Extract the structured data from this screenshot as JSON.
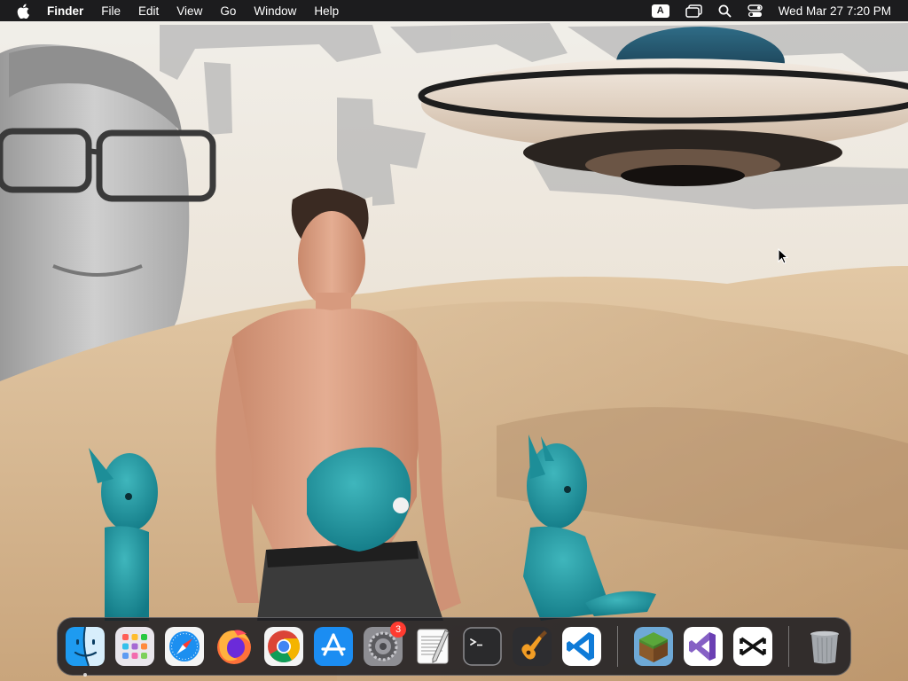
{
  "menubar": {
    "app_name": "Finder",
    "menus": [
      "File",
      "Edit",
      "View",
      "Go",
      "Window",
      "Help"
    ],
    "input_source": "A",
    "clock": "Wed Mar 27  7:20 PM",
    "status_icons": [
      "input-source-icon",
      "screen-mirroring-icon",
      "spotlight-search-icon",
      "control-center-icon"
    ]
  },
  "dock": {
    "apps": [
      {
        "name": "Finder",
        "icon": "finder-icon",
        "running": true
      },
      {
        "name": "Launchpad",
        "icon": "launchpad-icon"
      },
      {
        "name": "Safari",
        "icon": "safari-icon"
      },
      {
        "name": "Firefox",
        "icon": "firefox-icon"
      },
      {
        "name": "Google Chrome",
        "icon": "chrome-icon"
      },
      {
        "name": "App Store",
        "icon": "app-store-icon"
      },
      {
        "name": "System Settings",
        "icon": "system-settings-icon",
        "badge": "3"
      },
      {
        "name": "TextEdit",
        "icon": "textedit-icon"
      },
      {
        "name": "Terminal",
        "icon": "terminal-icon"
      },
      {
        "name": "GarageBand",
        "icon": "garageband-icon"
      },
      {
        "name": "Visual Studio Code",
        "icon": "vscode-icon"
      },
      {
        "name": "Minecraft",
        "icon": "minecraft-icon"
      },
      {
        "name": "Visual Studio",
        "icon": "visual-studio-icon"
      },
      {
        "name": "CapCut",
        "icon": "capcut-icon"
      },
      {
        "name": "Trash",
        "icon": "trash-icon"
      }
    ]
  },
  "colors": {
    "menubar_bg": "#1c1c1e",
    "badge_red": "#ff3b30",
    "vscode_blue": "#0f7bd8"
  }
}
